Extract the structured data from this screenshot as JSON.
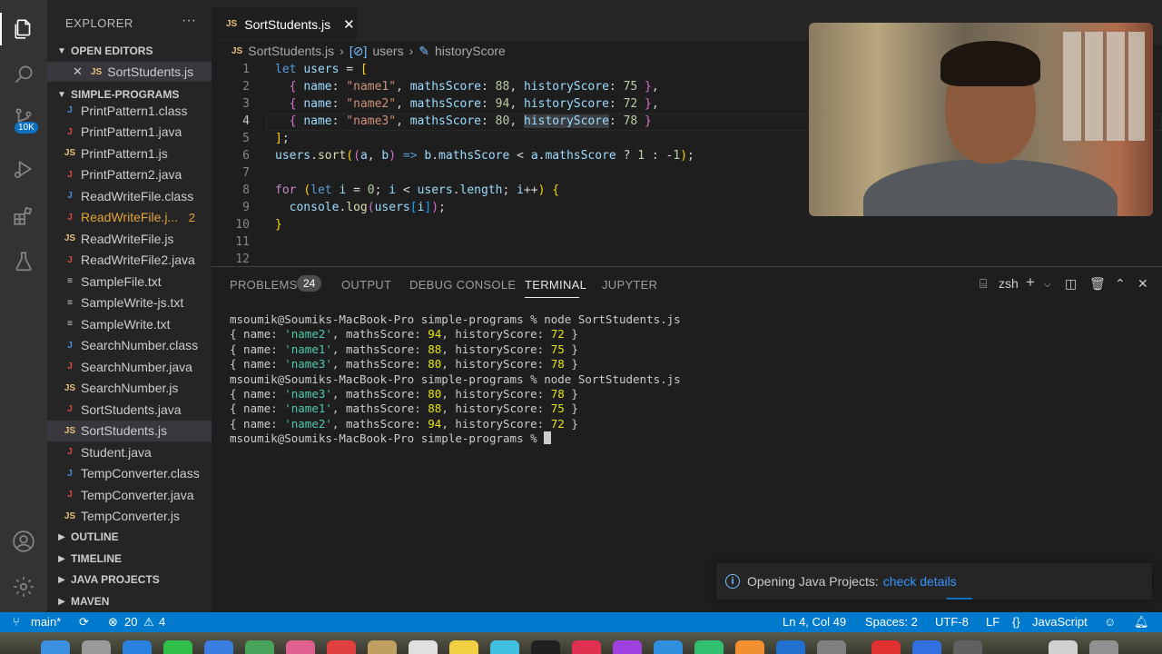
{
  "activity_bar": {
    "icons": [
      "files-icon",
      "search-icon",
      "source-control-icon",
      "run-debug-icon",
      "extensions-icon",
      "testing-icon",
      "account-icon",
      "settings-gear-icon"
    ],
    "source_control_badge": "10K"
  },
  "sidebar": {
    "title": "EXPLORER",
    "more": "···",
    "open_editors_label": "OPEN EDITORS",
    "open_editor_file": "SortStudents.js",
    "project_label": "SIMPLE-PROGRAMS",
    "files": [
      {
        "name": "PrintPattern1.class",
        "type": "class"
      },
      {
        "name": "PrintPattern1.java",
        "type": "java"
      },
      {
        "name": "PrintPattern1.js",
        "type": "js"
      },
      {
        "name": "PrintPattern2.java",
        "type": "java"
      },
      {
        "name": "ReadWriteFile.class",
        "type": "class"
      },
      {
        "name": "ReadWriteFile.j...",
        "type": "java",
        "problems": "2"
      },
      {
        "name": "ReadWriteFile.js",
        "type": "js"
      },
      {
        "name": "ReadWriteFile2.java",
        "type": "java"
      },
      {
        "name": "SampleFile.txt",
        "type": "txt"
      },
      {
        "name": "SampleWrite-js.txt",
        "type": "txt"
      },
      {
        "name": "SampleWrite.txt",
        "type": "txt"
      },
      {
        "name": "SearchNumber.class",
        "type": "class"
      },
      {
        "name": "SearchNumber.java",
        "type": "java"
      },
      {
        "name": "SearchNumber.js",
        "type": "js"
      },
      {
        "name": "SortStudents.java",
        "type": "java"
      },
      {
        "name": "SortStudents.js",
        "type": "js",
        "selected": true
      },
      {
        "name": "Student.java",
        "type": "java"
      },
      {
        "name": "TempConverter.class",
        "type": "class"
      },
      {
        "name": "TempConverter.java",
        "type": "java"
      },
      {
        "name": "TempConverter.js",
        "type": "js"
      }
    ],
    "sections": [
      "OUTLINE",
      "TIMELINE",
      "JAVA PROJECTS",
      "MAVEN"
    ]
  },
  "editor": {
    "tab_label": "SortStudents.js",
    "tab_icon": "JS",
    "breadcrumb": [
      "SortStudents.js",
      "users",
      "historyScore"
    ],
    "line_numbers": [
      "1",
      "2",
      "3",
      "4",
      "5",
      "6",
      "7",
      "8",
      "9",
      "10",
      "11",
      "12"
    ]
  },
  "panel": {
    "tabs": [
      "PROBLEMS",
      "OUTPUT",
      "DEBUG CONSOLE",
      "TERMINAL",
      "JUPYTER"
    ],
    "problems_count": "24",
    "active_tab": "TERMINAL",
    "shell": "zsh",
    "prompt": "msoumik@Soumiks-MacBook-Pro simple-programs %",
    "command": "node SortStudents.js"
  },
  "notification": {
    "message": "Opening Java Projects:",
    "link": "check details"
  },
  "statusbar": {
    "branch": "main*",
    "errors": "20",
    "warnings": "4",
    "position": "Ln 4, Col 49",
    "spaces": "Spaces: 2",
    "encoding": "UTF-8",
    "eol": "LF",
    "language": "JavaScript"
  },
  "colors": {
    "statusbar": "#007acc",
    "sidebar": "#252526",
    "editor": "#1e1e1e",
    "activity": "#333333"
  }
}
